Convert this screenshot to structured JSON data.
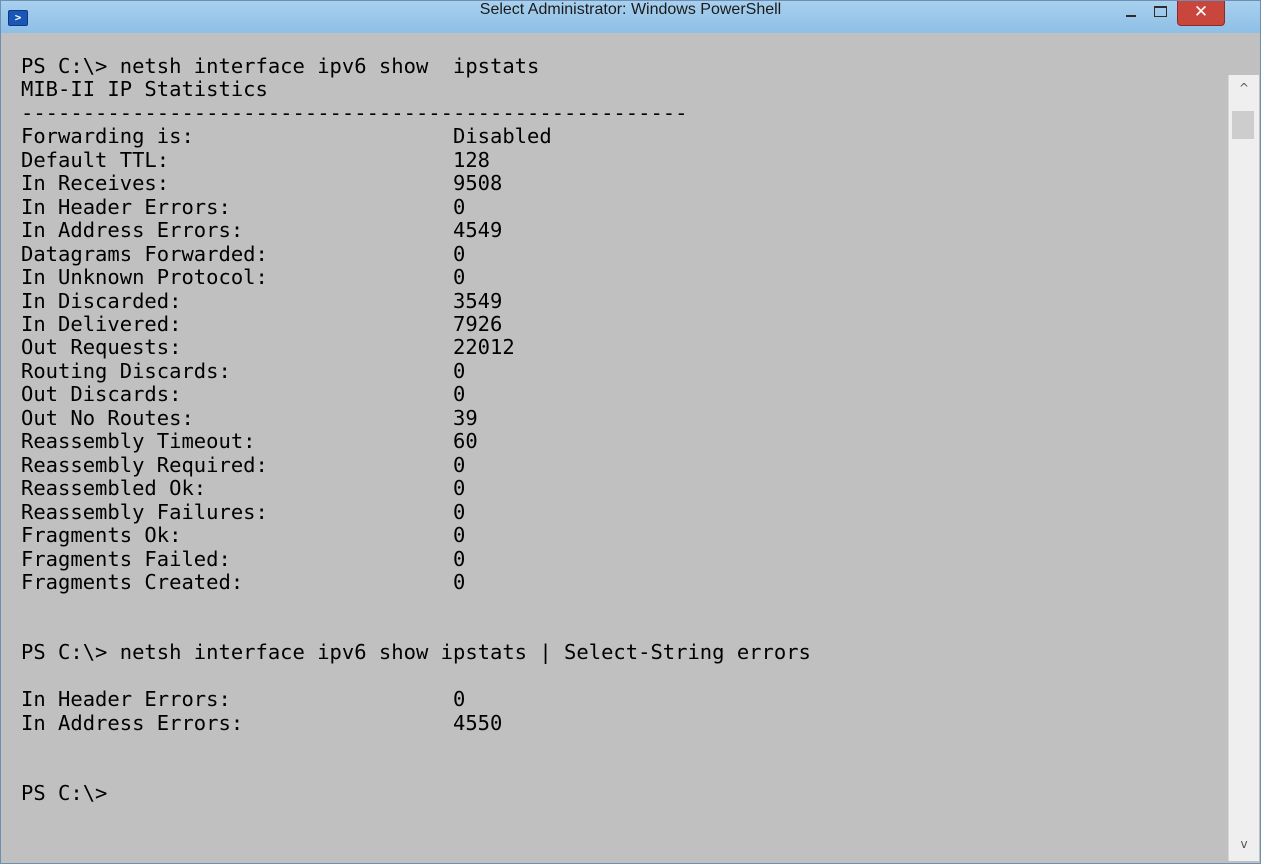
{
  "window": {
    "title": "Select Administrator: Windows PowerShell"
  },
  "controls": {
    "minimize": "",
    "maximize": "",
    "close": "✕"
  },
  "scrollbar": {
    "up_glyph": "^",
    "down_glyph": "v"
  },
  "console": {
    "lines": [
      "PS C:\\> netsh interface ipv6 show  ipstats",
      "MIB-II IP Statistics",
      "------------------------------------------------------",
      "Forwarding is:                     Disabled",
      "Default TTL:                       128",
      "In Receives:                       9508",
      "In Header Errors:                  0",
      "In Address Errors:                 4549",
      "Datagrams Forwarded:               0",
      "In Unknown Protocol:               0",
      "In Discarded:                      3549",
      "In Delivered:                      7926",
      "Out Requests:                      22012",
      "Routing Discards:                  0",
      "Out Discards:                      0",
      "Out No Routes:                     39",
      "Reassembly Timeout:                60",
      "Reassembly Required:               0",
      "Reassembled Ok:                    0",
      "Reassembly Failures:               0",
      "Fragments Ok:                      0",
      "Fragments Failed:                  0",
      "Fragments Created:                 0",
      "",
      "",
      "PS C:\\> netsh interface ipv6 show ipstats | Select-String errors",
      "",
      "In Header Errors:                  0",
      "In Address Errors:                 4550",
      "",
      "",
      "PS C:\\>"
    ]
  }
}
